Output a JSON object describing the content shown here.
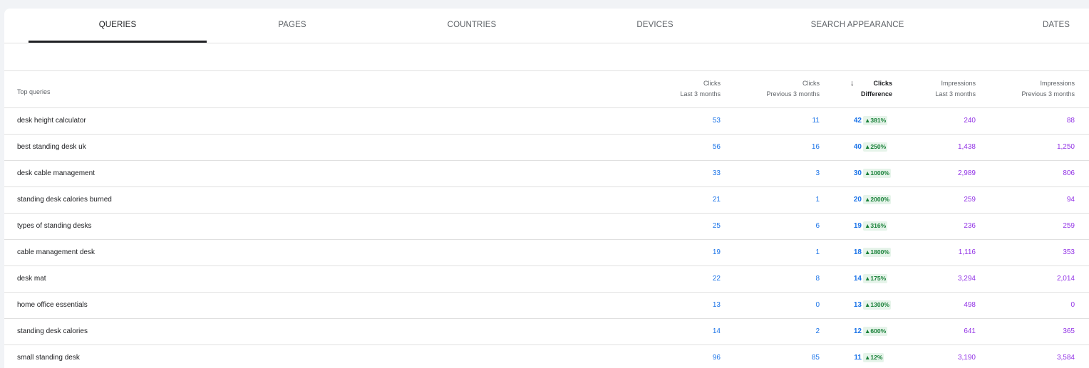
{
  "tabs": [
    "QUERIES",
    "PAGES",
    "COUNTRIES",
    "DEVICES",
    "SEARCH APPEARANCE",
    "DATES"
  ],
  "active_tab": "QUERIES",
  "table": {
    "query_header": "Top queries",
    "columns": [
      {
        "line1": "Clicks",
        "line2": "Last 3 months"
      },
      {
        "line1": "Clicks",
        "line2": "Previous 3 months"
      },
      {
        "line1": "Clicks",
        "line2": "Difference",
        "sorted": "descending",
        "sort_icon": "arrow-down-icon"
      },
      {
        "line1": "Impressions",
        "line2": "Last 3 months"
      },
      {
        "line1": "Impressions",
        "line2": "Previous 3 months"
      }
    ],
    "rows": [
      {
        "query": "desk height calculator",
        "clicks": "53",
        "clicks_prev": "11",
        "diff": "42",
        "pct": "▲381%",
        "impressions": "240",
        "impressions_prev": "88"
      },
      {
        "query": "best standing desk uk",
        "clicks": "56",
        "clicks_prev": "16",
        "diff": "40",
        "pct": "▲250%",
        "impressions": "1,438",
        "impressions_prev": "1,250"
      },
      {
        "query": "desk cable management",
        "clicks": "33",
        "clicks_prev": "3",
        "diff": "30",
        "pct": "▲1000%",
        "impressions": "2,989",
        "impressions_prev": "806"
      },
      {
        "query": "standing desk calories burned",
        "clicks": "21",
        "clicks_prev": "1",
        "diff": "20",
        "pct": "▲2000%",
        "impressions": "259",
        "impressions_prev": "94"
      },
      {
        "query": "types of standing desks",
        "clicks": "25",
        "clicks_prev": "6",
        "diff": "19",
        "pct": "▲316%",
        "impressions": "236",
        "impressions_prev": "259"
      },
      {
        "query": "cable management desk",
        "clicks": "19",
        "clicks_prev": "1",
        "diff": "18",
        "pct": "▲1800%",
        "impressions": "1,116",
        "impressions_prev": "353"
      },
      {
        "query": "desk mat",
        "clicks": "22",
        "clicks_prev": "8",
        "diff": "14",
        "pct": "▲175%",
        "impressions": "3,294",
        "impressions_prev": "2,014"
      },
      {
        "query": "home office essentials",
        "clicks": "13",
        "clicks_prev": "0",
        "diff": "13",
        "pct": "▲1300%",
        "impressions": "498",
        "impressions_prev": "0"
      },
      {
        "query": "standing desk calories",
        "clicks": "14",
        "clicks_prev": "2",
        "diff": "12",
        "pct": "▲600%",
        "impressions": "641",
        "impressions_prev": "365"
      },
      {
        "query": "small standing desk",
        "clicks": "96",
        "clicks_prev": "85",
        "diff": "11",
        "pct": "▲12%",
        "impressions": "3,190",
        "impressions_prev": "3,584"
      }
    ]
  },
  "colors": {
    "clicks": "#1a73e8",
    "impressions": "#9334e6",
    "badge_text": "#188038",
    "badge_bg": "#e6f4ea"
  }
}
